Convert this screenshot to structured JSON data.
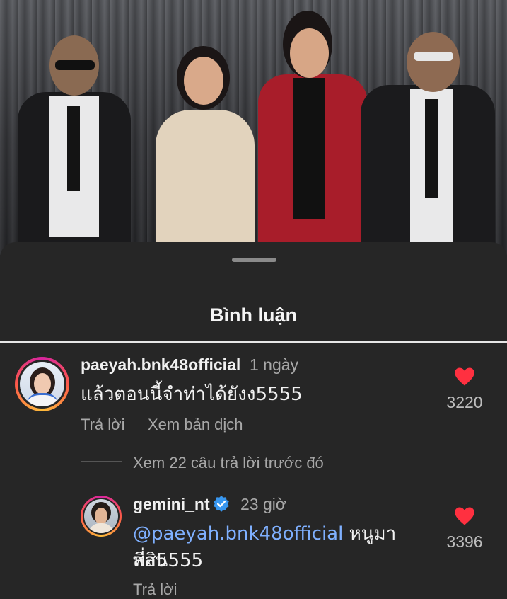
{
  "sheet": {
    "title": "Bình luận"
  },
  "comments": [
    {
      "username": "paeyah.bnk48official",
      "time": "1 ngày",
      "text": "แล้วตอนนี้จำท่าได้ยังง5555",
      "likes": "3220",
      "reply_label": "Trả lời",
      "translate_label": "Xem bản dịch",
      "avatar_icon": "profile-photo"
    }
  ],
  "view_replies": "Xem 22 câu trả lời trước đó",
  "reply": {
    "username": "gemini_nt",
    "verified": true,
    "time": "23 giờ",
    "mention": "@paeyah.bnk48official",
    "text_after_mention": " หนูมาสอน",
    "text_line2": "พี่สิ5555",
    "likes": "3396",
    "reply_label": "Trả lời"
  },
  "colors": {
    "like_heart": "#ff3040",
    "mention": "#7fb0ff",
    "verified_badge": "#3897f0",
    "background": "#262626"
  }
}
